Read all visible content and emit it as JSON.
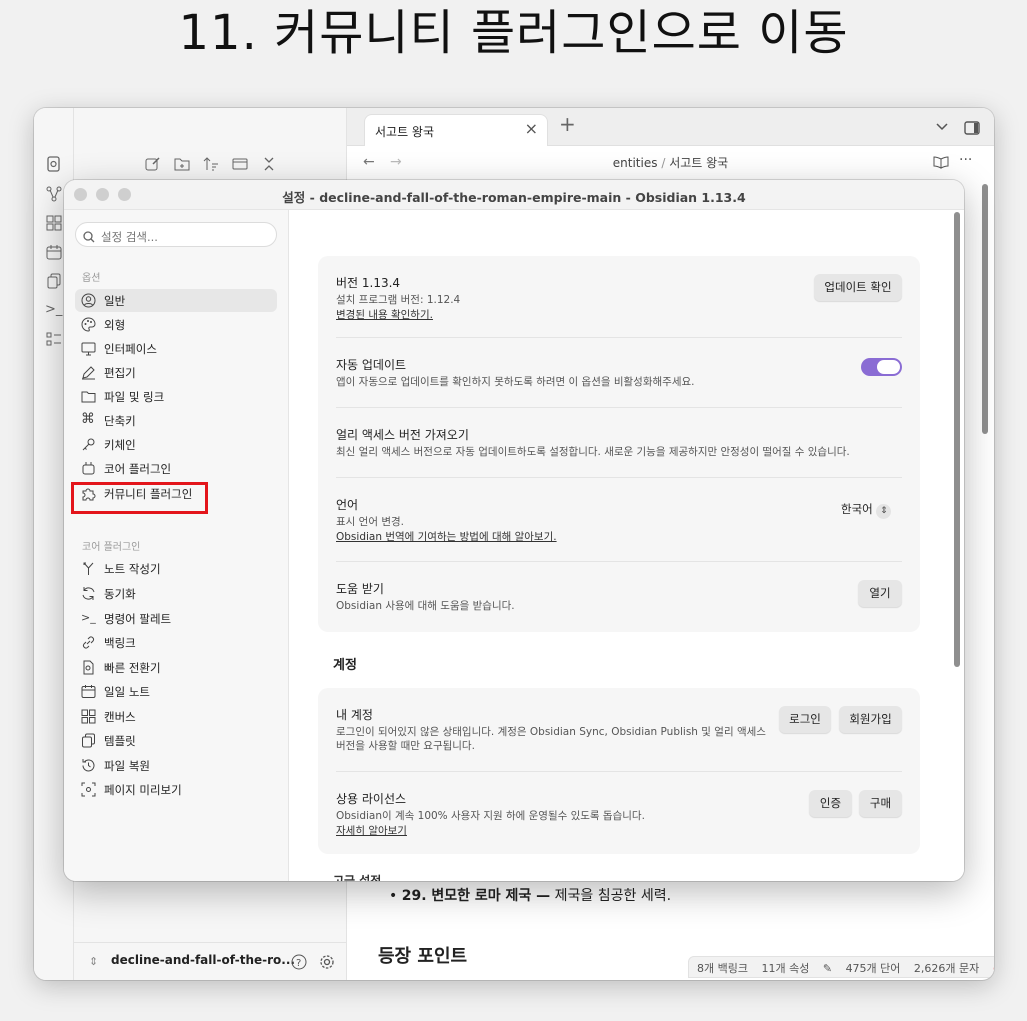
{
  "headline": "11. 커뮤니티 플러그인으로 이동",
  "main": {
    "tab_title": "서고트 왕국",
    "breadcrumb_parent": "entities",
    "breadcrumb_sep": "/",
    "breadcrumb_current": "서고트 왕국",
    "content_line_bold": "29. 변모한 로마 제국 —",
    "content_line_rest": " 제국을 침공한 세력.",
    "content_heading": "등장 포인트",
    "vault_name": "decline-and-fall-of-the-ro...",
    "status": {
      "backlinks": "8개 백링크",
      "properties": "11개 속성",
      "words": "475개 단어",
      "chars": "2,626개 문자"
    }
  },
  "settings": {
    "title": "설정 - decline-and-fall-of-the-roman-empire-main - Obsidian 1.13.4",
    "search_placeholder": "설정 검색...",
    "options_header": "옵션",
    "options": [
      {
        "label": "일반",
        "icon": "user-circle-icon"
      },
      {
        "label": "외형",
        "icon": "palette-icon"
      },
      {
        "label": "인터페이스",
        "icon": "monitor-icon"
      },
      {
        "label": "편집기",
        "icon": "pen-icon"
      },
      {
        "label": "파일 및 링크",
        "icon": "folder-icon"
      },
      {
        "label": "단축키",
        "icon": "command-icon"
      },
      {
        "label": "키체인",
        "icon": "key-icon"
      },
      {
        "label": "코어 플러그인",
        "icon": "plug-icon"
      },
      {
        "label": "커뮤니티 플러그인",
        "icon": "puzzle-icon"
      }
    ],
    "core_header": "코어 플러그인",
    "core_plugins": [
      {
        "label": "노트 작성기",
        "icon": "merge-icon"
      },
      {
        "label": "동기화",
        "icon": "sync-icon"
      },
      {
        "label": "명령어 팔레트",
        "icon": "terminal-icon"
      },
      {
        "label": "백링크",
        "icon": "link-icon"
      },
      {
        "label": "빠른 전환기",
        "icon": "file-search-icon"
      },
      {
        "label": "일일 노트",
        "icon": "calendar-icon"
      },
      {
        "label": "캔버스",
        "icon": "grid-icon"
      },
      {
        "label": "템플릿",
        "icon": "copy-icon"
      },
      {
        "label": "파일 복원",
        "icon": "history-icon"
      },
      {
        "label": "페이지 미리보기",
        "icon": "eye-icon"
      }
    ],
    "general": {
      "version_title": "버전 1.13.4",
      "version_desc": "설치 프로그램 버전: 1.12.4",
      "version_link": "변경된 내용 확인하기.",
      "update_button": "업데이트 확인",
      "auto_update_title": "자동 업데이트",
      "auto_update_desc": "앱이 자동으로 업데이트를 확인하지 못하도록 하려면 이 옵션을 비활성화해주세요.",
      "auto_update_on": true,
      "early_title": "얼리 액세스 버전 가져오기",
      "early_desc": "최신 얼리 액세스 버전으로 자동 업데이트하도록 설정합니다. 새로운 기능을 제공하지만 안정성이 떨어질 수 있습니다.",
      "language_title": "언어",
      "language_desc": "표시 언어 변경.",
      "language_link": "Obsidian 번역에 기여하는 방법에 대해 알아보기.",
      "language_value": "한국어",
      "help_title": "도움 받기",
      "help_desc": "Obsidian 사용에 대해 도움을 받습니다.",
      "help_button": "열기"
    },
    "account_section": "계정",
    "account": {
      "my_title": "내 계정",
      "my_desc_1": "로그인이 되어있지 않은 상태입니다. 계정은 Obsidian Sync, Obsidian Publish 및 얼리 액세스",
      "my_desc_2": "버전을 사용할 때만 요구됩니다.",
      "login_button": "로그인",
      "signup_button": "회원가입",
      "license_title": "상용 라이선스",
      "license_desc": "Obsidian이 계속 100% 사용자 지원 하에 운영될수 있도록 돕습니다.",
      "license_link": "자세히 알아보기",
      "auth_button": "인증",
      "buy_button": "구매"
    },
    "cut_section": "고급 설정"
  },
  "colors": {
    "accent": "#8a6cd4",
    "highlight": "#e3151b"
  }
}
